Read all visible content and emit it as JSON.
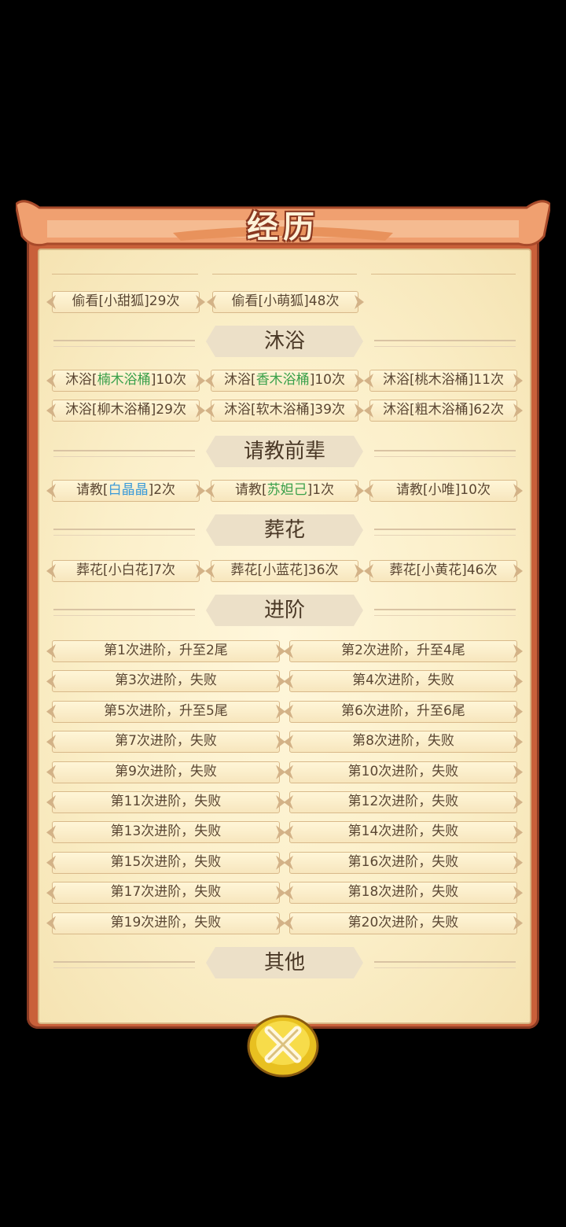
{
  "header": {
    "title": "经历"
  },
  "top_partial": [
    {
      "text": "偷看[小甜狐]29次"
    },
    {
      "text": "偷看[小萌狐]48次"
    }
  ],
  "sections": {
    "bath": {
      "title": "沐浴"
    },
    "consult": {
      "title": "请教前辈"
    },
    "bury": {
      "title": "葬花"
    },
    "advance": {
      "title": "进阶"
    },
    "other": {
      "title": "其他"
    }
  },
  "bath_items": [
    {
      "pre": "沐浴[",
      "hl": "楠木浴桶",
      "post": "]10次",
      "color": "green"
    },
    {
      "pre": "沐浴[",
      "hl": "香木浴桶",
      "post": "]10次",
      "color": "green"
    },
    {
      "pre": "沐浴[桃木浴桶]11次",
      "hl": "",
      "post": ""
    },
    {
      "pre": "沐浴[柳木浴桶]29次",
      "hl": "",
      "post": ""
    },
    {
      "pre": "沐浴[软木浴桶]39次",
      "hl": "",
      "post": ""
    },
    {
      "pre": "沐浴[粗木浴桶]62次",
      "hl": "",
      "post": ""
    }
  ],
  "consult_items": [
    {
      "pre": "请教[",
      "hl": "白晶晶",
      "post": "]2次",
      "color": "blue"
    },
    {
      "pre": "请教[",
      "hl": "苏妲己",
      "post": "]1次",
      "color": "green"
    },
    {
      "pre": "请教[小唯]10次",
      "hl": "",
      "post": ""
    }
  ],
  "bury_items": [
    {
      "text": "葬花[小白花]7次"
    },
    {
      "text": "葬花[小蓝花]36次"
    },
    {
      "text": "葬花[小黄花]46次"
    }
  ],
  "advance_items": [
    "第1次进阶，升至2尾",
    "第2次进阶，升至4尾",
    "第3次进阶，失败",
    "第4次进阶，失败",
    "第5次进阶，升至5尾",
    "第6次进阶，升至6尾",
    "第7次进阶，失败",
    "第8次进阶，失败",
    "第9次进阶，失败",
    "第10次进阶，失败",
    "第11次进阶，失败",
    "第12次进阶，失败",
    "第13次进阶，失败",
    "第14次进阶，失败",
    "第15次进阶，失败",
    "第16次进阶，失败",
    "第17次进阶，失败",
    "第18次进阶，失败",
    "第19次进阶，失败",
    "第20次进阶，失败"
  ],
  "colors": {
    "frame": "#c9603a",
    "parchment": "#fbefc9",
    "highlight_green": "#3aa04a",
    "highlight_blue": "#3a9ad8",
    "close_button": "#e8c020"
  },
  "close_button": {
    "icon": "close-icon"
  }
}
